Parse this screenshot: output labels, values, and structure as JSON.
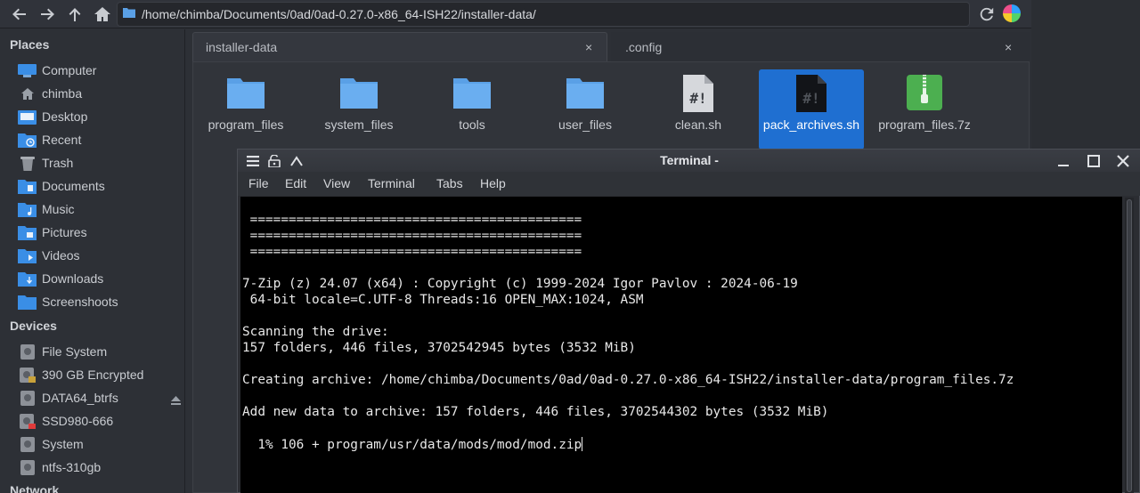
{
  "file_manager": {
    "location_path": "/home/chimba/Documents/0ad/0ad-0.27.0-x86_64-ISH22/installer-data/",
    "toolbar_icons": [
      "back-arrow-icon",
      "forward-arrow-icon",
      "up-arrow-icon",
      "home-icon",
      "folder-icon",
      "refresh-icon",
      "app-icon"
    ],
    "sidebar": {
      "places_header": "Places",
      "places": [
        {
          "label": "Computer",
          "icon": "computer-icon"
        },
        {
          "label": "chimba",
          "icon": "home-icon"
        },
        {
          "label": "Desktop",
          "icon": "desktop-folder-icon"
        },
        {
          "label": "Recent",
          "icon": "recent-folder-icon"
        },
        {
          "label": "Trash",
          "icon": "trash-icon"
        },
        {
          "label": "Documents",
          "icon": "documents-folder-icon"
        },
        {
          "label": "Music",
          "icon": "music-folder-icon"
        },
        {
          "label": "Pictures",
          "icon": "pictures-folder-icon"
        },
        {
          "label": "Videos",
          "icon": "videos-folder-icon"
        },
        {
          "label": "Downloads",
          "icon": "downloads-folder-icon"
        },
        {
          "label": "Screenshoots",
          "icon": "folder-icon"
        }
      ],
      "devices_header": "Devices",
      "devices": [
        {
          "label": "File System",
          "icon": "drive-icon"
        },
        {
          "label": "390 GB Encrypted",
          "icon": "encrypted-drive-icon"
        },
        {
          "label": "DATA64_btrfs",
          "icon": "drive-icon"
        },
        {
          "label": "SSD980-666",
          "icon": "drive-error-icon"
        },
        {
          "label": "System",
          "icon": "drive-icon"
        },
        {
          "label": "ntfs-310gb",
          "icon": "drive-icon"
        }
      ],
      "network_header": "Network"
    },
    "tabs": [
      {
        "label": "installer-data",
        "close": "×"
      },
      {
        "label": ".config",
        "close": "×"
      }
    ],
    "files": [
      {
        "name": "program_files",
        "icon": "folder-icon"
      },
      {
        "name": "system_files",
        "icon": "folder-icon"
      },
      {
        "name": "tools",
        "icon": "folder-icon"
      },
      {
        "name": "user_files",
        "icon": "folder-icon"
      },
      {
        "name": "clean.sh",
        "icon": "shell-script-icon"
      },
      {
        "name": "pack_archives.sh",
        "icon": "shell-script-icon",
        "selected": true
      },
      {
        "name": "program_files.7z",
        "icon": "archive-icon"
      }
    ]
  },
  "terminal": {
    "title": "Terminal -",
    "menu": [
      "File",
      "Edit",
      "View",
      "Terminal",
      "Tabs",
      "Help"
    ],
    "lines": [
      " ===========================================",
      " ===========================================",
      " ===========================================",
      "",
      "7-Zip (z) 24.07 (x64) : Copyright (c) 1999-2024 Igor Pavlov : 2024-06-19",
      " 64-bit locale=C.UTF-8 Threads:16 OPEN_MAX:1024, ASM",
      "",
      "Scanning the drive:",
      "157 folders, 446 files, 3702542945 bytes (3532 MiB)",
      "",
      "Creating archive: /home/chimba/Documents/0ad/0ad-0.27.0-x86_64-ISH22/installer-data/program_files.7z",
      "",
      "Add new data to archive: 157 folders, 446 files, 3702544302 bytes (3532 MiB)",
      "",
      "  1% 106 + program/usr/data/mods/mod/mod.zip"
    ]
  },
  "colors": {
    "accent": "#1f6fd1",
    "folder": "#5aa0e6",
    "archive": "#4caf50",
    "terminal_bg": "#000000"
  }
}
